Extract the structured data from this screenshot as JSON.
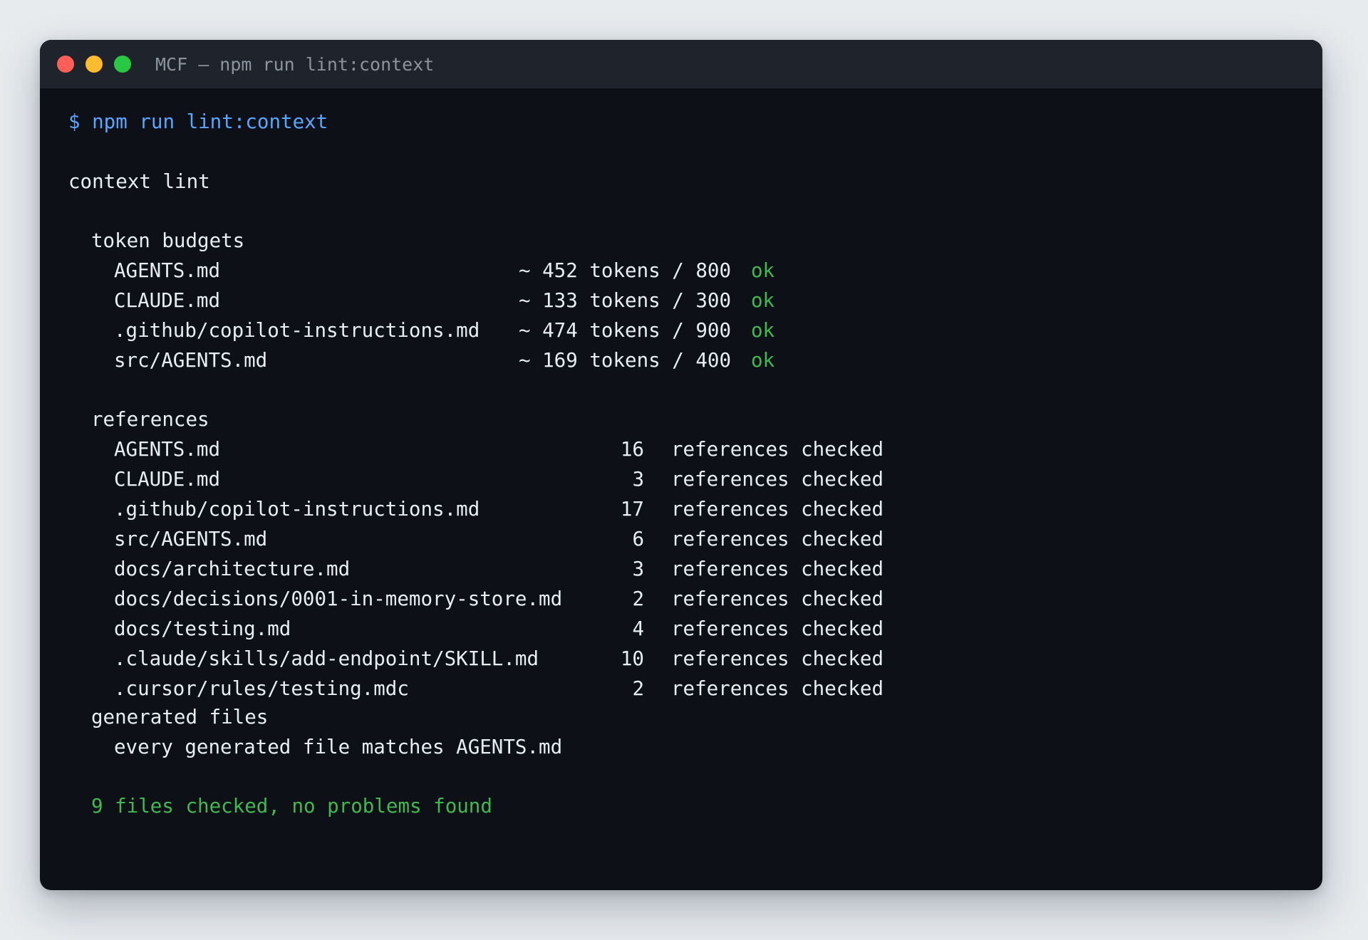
{
  "window": {
    "title": "MCF — npm run lint:context"
  },
  "terminal": {
    "command": "$ npm run lint:context",
    "heading": "context lint",
    "token_budgets": {
      "label": "token budgets",
      "rows": [
        {
          "file": "AGENTS.md",
          "budget": "~ 452 tokens / 800",
          "status": "ok"
        },
        {
          "file": "CLAUDE.md",
          "budget": "~ 133 tokens / 300",
          "status": "ok"
        },
        {
          "file": ".github/copilot-instructions.md",
          "budget": "~ 474 tokens / 900",
          "status": "ok"
        },
        {
          "file": "src/AGENTS.md",
          "budget": "~ 169 tokens / 400",
          "status": "ok"
        }
      ]
    },
    "references": {
      "label": "references",
      "rows": [
        {
          "file": "AGENTS.md",
          "count": "16",
          "text": "references checked"
        },
        {
          "file": "CLAUDE.md",
          "count": "3",
          "text": "references checked"
        },
        {
          "file": ".github/copilot-instructions.md",
          "count": "17",
          "text": "references checked"
        },
        {
          "file": "src/AGENTS.md",
          "count": "6",
          "text": "references checked"
        },
        {
          "file": "docs/architecture.md",
          "count": "3",
          "text": "references checked"
        },
        {
          "file": "docs/decisions/0001-in-memory-store.md",
          "count": "2",
          "text": "references checked"
        },
        {
          "file": "docs/testing.md",
          "count": "4",
          "text": "references checked"
        },
        {
          "file": ".claude/skills/add-endpoint/SKILL.md",
          "count": "10",
          "text": "references checked"
        },
        {
          "file": ".cursor/rules/testing.mdc",
          "count": "2",
          "text": "references checked"
        }
      ]
    },
    "generated_files": {
      "label": "generated files",
      "message": "every generated file matches AGENTS.md"
    },
    "summary": "9 files checked, no problems found"
  },
  "colors": {
    "prompt": "#58a6ff",
    "ok": "#3fb950",
    "text": "#e6edf3",
    "background": "#0d1117",
    "titlebar": "#1f242c"
  }
}
